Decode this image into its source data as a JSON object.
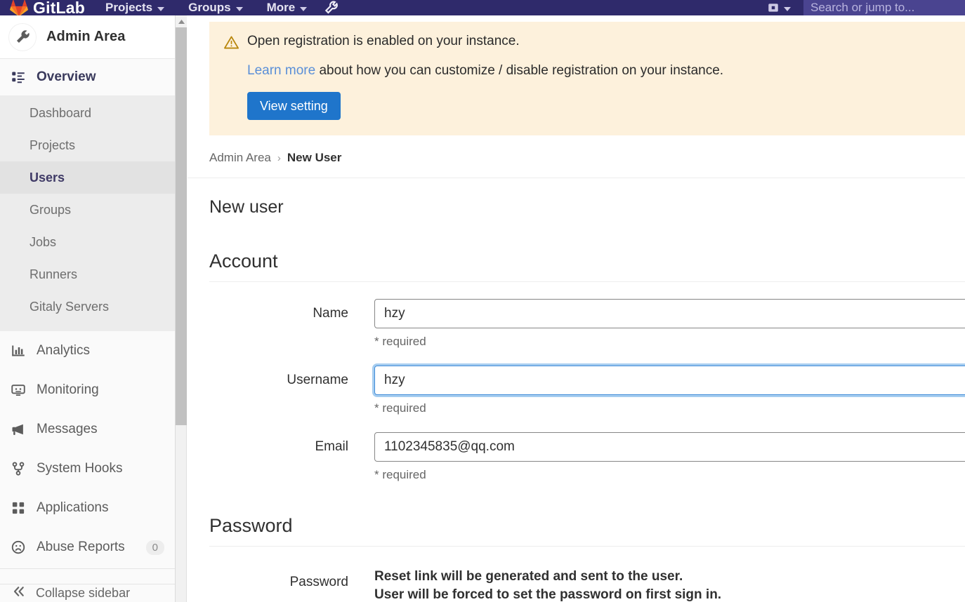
{
  "topnav": {
    "brand": "GitLab",
    "items": [
      {
        "label": "Projects",
        "icon": "chevron-down-icon"
      },
      {
        "label": "Groups",
        "icon": "chevron-down-icon"
      },
      {
        "label": "More",
        "icon": "chevron-down-icon"
      }
    ],
    "admin_icon": "wrench-icon",
    "issues_icon": "issues-icon",
    "search_placeholder": "Search or jump to..."
  },
  "sidebar": {
    "context_title": "Admin Area",
    "context_icon": "wrench-icon",
    "overview": {
      "label": "Overview",
      "icon": "overview-icon",
      "items": [
        {
          "label": "Dashboard",
          "active": false
        },
        {
          "label": "Projects",
          "active": false
        },
        {
          "label": "Users",
          "active": true
        },
        {
          "label": "Groups",
          "active": false
        },
        {
          "label": "Jobs",
          "active": false
        },
        {
          "label": "Runners",
          "active": false
        },
        {
          "label": "Gitaly Servers",
          "active": false
        }
      ]
    },
    "items": [
      {
        "label": "Analytics",
        "icon": "chart-icon",
        "badge": ""
      },
      {
        "label": "Monitoring",
        "icon": "monitor-icon",
        "badge": ""
      },
      {
        "label": "Messages",
        "icon": "megaphone-icon",
        "badge": ""
      },
      {
        "label": "System Hooks",
        "icon": "hook-icon",
        "badge": ""
      },
      {
        "label": "Applications",
        "icon": "apps-grid-icon",
        "badge": ""
      },
      {
        "label": "Abuse Reports",
        "icon": "abuse-icon",
        "badge": "0"
      }
    ],
    "collapse_label": "Collapse sidebar",
    "collapse_icon": "chevron-double-left-icon"
  },
  "alert": {
    "icon": "warning-triangle-icon",
    "title": "Open registration is enabled on your instance.",
    "link_text": "Learn more",
    "body_text": " about how you can customize / disable registration on your instance.",
    "button_label": "View setting",
    "bg_color": "#fdf1dc",
    "button_color": "#1f75cb"
  },
  "breadcrumb": {
    "root": "Admin Area",
    "separator": "›",
    "current": "New User"
  },
  "page": {
    "title": "New user"
  },
  "account": {
    "heading": "Account",
    "fields": [
      {
        "label": "Name",
        "value": "hzy",
        "hint": "* required",
        "focused": false
      },
      {
        "label": "Username",
        "value": "hzy",
        "hint": "* required",
        "focused": true
      },
      {
        "label": "Email",
        "value": "1102345835@qq.com",
        "hint": "* required",
        "focused": false
      }
    ]
  },
  "password": {
    "heading": "Password",
    "label": "Password",
    "line1": "Reset link will be generated and sent to the user.",
    "line2": "User will be forced to set the password on first sign in."
  }
}
